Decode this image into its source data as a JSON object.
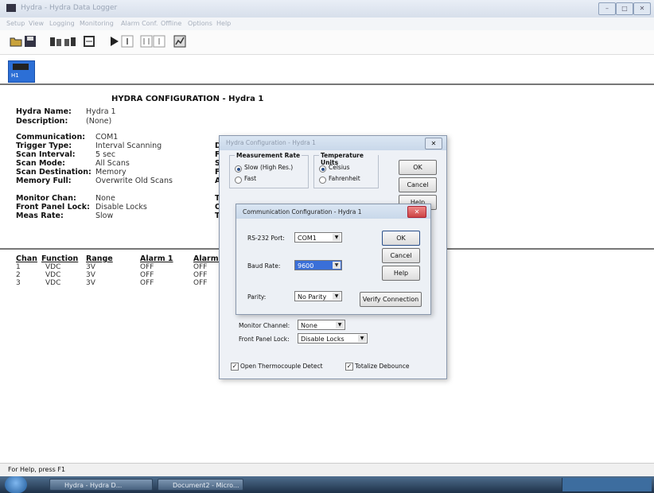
{
  "window": {
    "title": "Hydra - Hydra Data Logger",
    "min": "–",
    "max": "□",
    "close": "✕"
  },
  "menu": [
    "Setup",
    "View",
    "Logging",
    "Monitoring",
    "Alarm Conf.",
    "Offline",
    "Options",
    "Help"
  ],
  "device": {
    "label": "H1"
  },
  "config": {
    "title": "HYDRA CONFIGURATION - Hydra 1",
    "name_label": "Hydra Name:",
    "name_value": "Hydra 1",
    "desc_label": "Description:",
    "desc_value": "(None)",
    "fields": [
      {
        "label": "Communication:",
        "value": "COM1"
      },
      {
        "label": "Trigger Type:",
        "value": "Interval Scanning"
      },
      {
        "label": "Scan Interval:",
        "value": "5 sec"
      },
      {
        "label": "Scan Mode:",
        "value": "All Scans"
      },
      {
        "label": "Scan Destination:",
        "value": "Memory"
      },
      {
        "label": "Memory Full:",
        "value": "Overwrite Old Scans"
      }
    ],
    "fields2": [
      {
        "label": "Monitor Chan:",
        "value": "None"
      },
      {
        "label": "Front Panel Lock:",
        "value": "Disable Locks"
      },
      {
        "label": "Meas Rate:",
        "value": "Slow"
      }
    ],
    "right_letters": [
      "D",
      "F",
      "S",
      "F",
      "A"
    ],
    "right_letters2": [
      "T",
      "O",
      "T"
    ]
  },
  "table": {
    "headers": [
      "Chan",
      "Function",
      "Range",
      "Alarm 1",
      "Alarm 2"
    ],
    "rows": [
      [
        "1",
        "VDC",
        "3V",
        "OFF",
        "OFF"
      ],
      [
        "2",
        "VDC",
        "3V",
        "OFF",
        "OFF"
      ],
      [
        "3",
        "VDC",
        "3V",
        "OFF",
        "OFF"
      ]
    ]
  },
  "dialog_hydra": {
    "title": "Hydra Configuration - Hydra 1",
    "meas_rate_label": "Measurement Rate",
    "rate_slow": "Slow (High Res.)",
    "rate_fast": "Fast",
    "temp_label": "Temperature Units",
    "temp_c": "Celsius",
    "temp_f": "Fahrenheit",
    "ok": "OK",
    "cancel": "Cancel",
    "help": "Help",
    "monitor_label": "Monitor Channel:",
    "monitor_value": "None",
    "fpl_label": "Front Panel Lock:",
    "fpl_value": "Disable Locks",
    "open_tc": "Open Thermocouple Detect",
    "totalize": "Totalize Debounce"
  },
  "dialog_comm": {
    "title": "Communication Configuration - Hydra 1",
    "rs232_label": "RS-232 Port:",
    "rs232_value": "COM1",
    "baud_label": "Baud Rate:",
    "baud_value": "9600",
    "parity_label": "Parity:",
    "parity_value": "No Parity",
    "ok": "OK",
    "cancel": "Cancel",
    "help": "Help",
    "verify": "Verify Connection"
  },
  "status": "For Help, press F1",
  "taskbar": {
    "item1": "Hydra - Hydra D...",
    "item2": "Document2 - Micro..."
  },
  "colors": {
    "accent": "#2c6fd6",
    "selection": "#3a6fd8"
  }
}
